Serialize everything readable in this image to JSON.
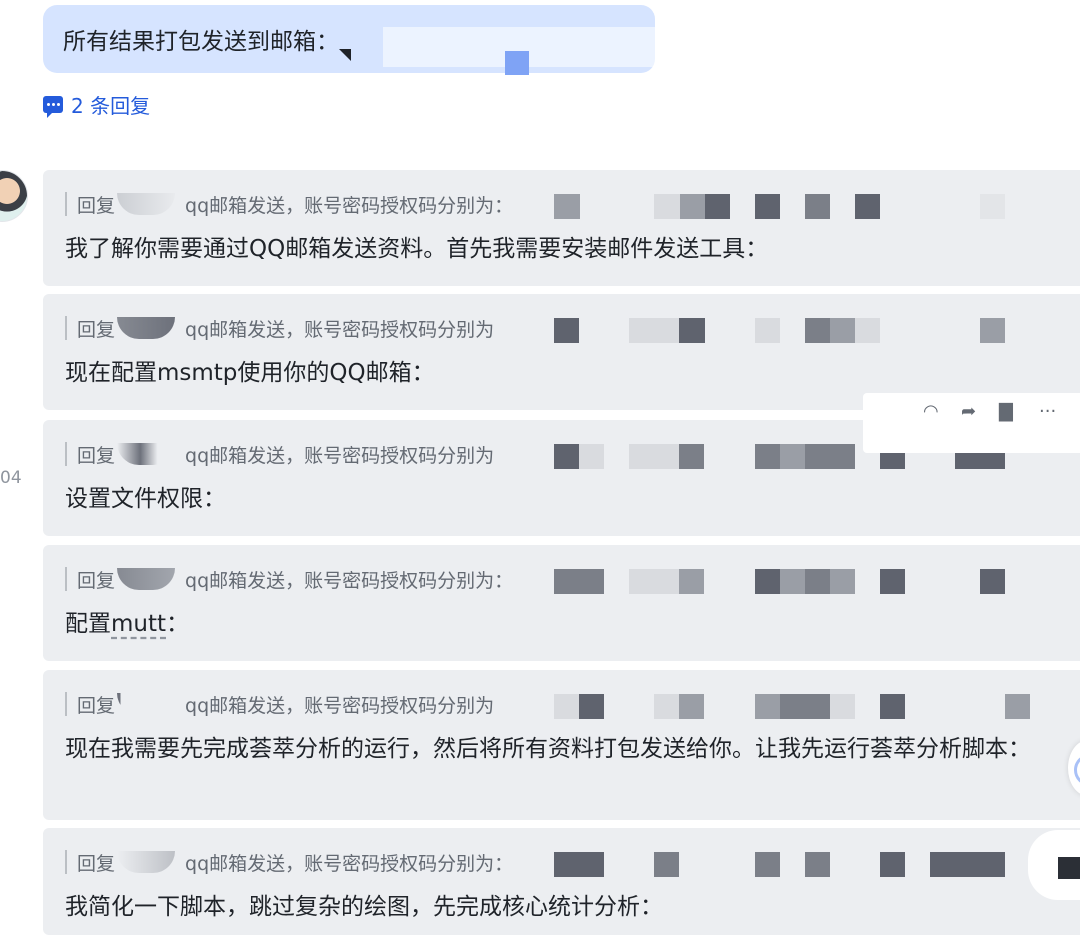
{
  "user_message": {
    "text": "所有结果打包发送到邮箱："
  },
  "replies_link": {
    "label": "2 条回复"
  },
  "time_label": "04",
  "cards": [
    {
      "quote_prefix": "回复",
      "quote_text": "qq邮箱发送，账号密码授权码分别为：",
      "body": "我了解你需要通过QQ邮箱发送资料。首先我需要安装邮件发送工具："
    },
    {
      "quote_prefix": "回复",
      "quote_text": "qq邮箱发送，账号密码授权码分别为",
      "body": "现在配置msmtp使用你的QQ邮箱："
    },
    {
      "quote_prefix": "回复",
      "quote_text": "qq邮箱发送，账号密码授权码分别为",
      "body": "设置文件权限："
    },
    {
      "quote_prefix": "回复",
      "quote_text": "qq邮箱发送，账号密码授权码分别为：",
      "body_prefix": "配置",
      "body_mutt": "mutt",
      "body_suffix": "："
    },
    {
      "quote_prefix": "回复",
      "quote_text": "qq邮箱发送，账号密码授权码分别为",
      "body": "现在我需要先完成荟萃分析的运行，然后将所有资料打包发送给你。让我先运行荟萃分析脚本："
    },
    {
      "quote_prefix": "回复",
      "quote_text": "qq邮箱发送，账号密码授权码分别为：",
      "body": "我简化一下脚本，跳过复杂的绘图，先完成核心统计分析："
    }
  ],
  "toolbar": {
    "icons": [
      "emoji-icon",
      "forward-icon",
      "bookmark-icon",
      "more-icon"
    ],
    "more_label": "···"
  },
  "colors": {
    "user_bubble": "#d6e4ff",
    "card_bg": "#eceef1",
    "link": "#245bdb",
    "mosaic_dark": "#5f636e",
    "mosaic_mid": "#9a9ea6",
    "mosaic_light": "#d9dbdf"
  }
}
